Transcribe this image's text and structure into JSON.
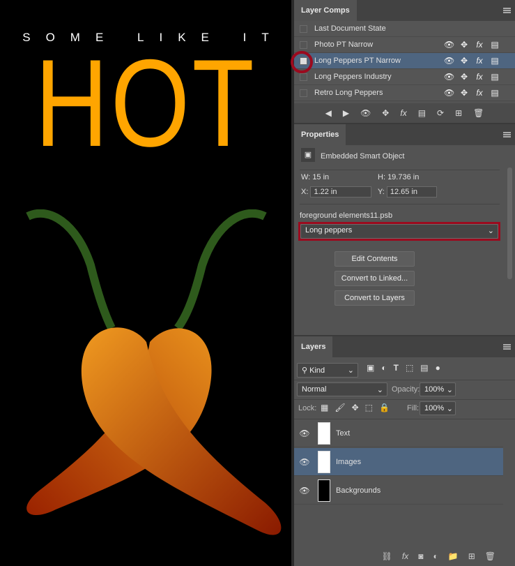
{
  "artwork": {
    "tagline": "SOME LIKE IT",
    "headline": "HOT",
    "headline_color": "#FFA500"
  },
  "layer_comps": {
    "tab": "Layer Comps",
    "items": [
      {
        "label": "Last Document State",
        "selected": false,
        "icons": false
      },
      {
        "label": "Photo PT Narrow",
        "selected": false,
        "icons": true
      },
      {
        "label": "Long Peppers PT Narrow",
        "selected": true,
        "icons": true
      },
      {
        "label": "Long Peppers Industry",
        "selected": false,
        "icons": true
      },
      {
        "label": "Retro Long Peppers",
        "selected": false,
        "icons": true
      }
    ],
    "toolbar": [
      "previous",
      "next",
      "visibility",
      "position",
      "fx",
      "appearance",
      "update",
      "new",
      "delete"
    ]
  },
  "properties": {
    "tab": "Properties",
    "type": "Embedded Smart Object",
    "w_label": "W:",
    "w": "15 in",
    "h_label": "H:",
    "h": "19.736 in",
    "x_label": "X:",
    "x": "1.22 in",
    "y_label": "Y:",
    "y": "12.65 in",
    "filename": "foreground elements11.psb",
    "comp_select": "Long peppers",
    "edit": "Edit Contents",
    "convert_linked": "Convert to Linked...",
    "convert_layers": "Convert to Layers"
  },
  "layers": {
    "tab": "Layers",
    "kind": "Kind",
    "blend": "Normal",
    "opacity_label": "Opacity:",
    "opacity": "100%",
    "lock_label": "Lock:",
    "fill_label": "Fill:",
    "fill": "100%",
    "items": [
      {
        "name": "Text",
        "selected": false
      },
      {
        "name": "Images",
        "selected": true
      },
      {
        "name": "Backgrounds",
        "selected": false
      }
    ]
  },
  "highlight_color": "#9b0a1e"
}
